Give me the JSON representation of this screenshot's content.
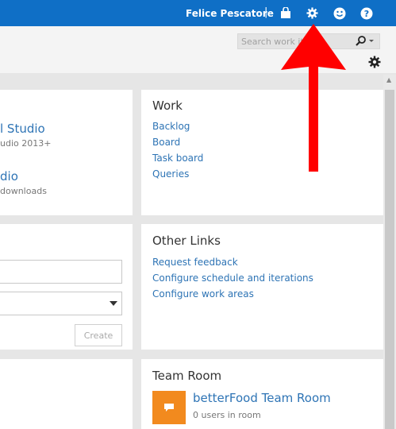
{
  "topbar": {
    "user_name": "Felice Pescatore",
    "separator": "|",
    "icons": [
      "bag-icon",
      "gear-icon",
      "smiley-icon",
      "help-icon"
    ],
    "background": "#0f6fc6"
  },
  "search": {
    "placeholder": "Search work item"
  },
  "left_top_card": {
    "link1": "l Studio",
    "sub1": "udio 2013+",
    "link2": "dio",
    "sub2": "downloads"
  },
  "work": {
    "title": "Work",
    "links": [
      "Backlog",
      "Board",
      "Task board",
      "Queries"
    ]
  },
  "other_links": {
    "title": "Other Links",
    "links": [
      "Request feedback",
      "Configure schedule and iterations",
      "Configure work areas"
    ]
  },
  "left_mid_card": {
    "create_label": "Create"
  },
  "team_room": {
    "title": "Team Room",
    "room_name": "betterFood Team Room",
    "users": "0 users in room",
    "icon_color": "#f28a1e"
  },
  "annotation": {
    "arrow_color": "#ff0000"
  }
}
